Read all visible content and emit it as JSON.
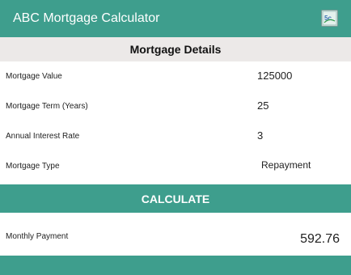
{
  "app": {
    "title": "ABC Mortgage Calculator",
    "icon": "calculator-icon",
    "accent_color": "#3e9e8d",
    "header_bg": "#ece9e8"
  },
  "section": {
    "title": "Mortgage Details"
  },
  "fields": {
    "value": {
      "label": "Mortgage Value",
      "value": "125000"
    },
    "term": {
      "label": "Mortgage Term (Years)",
      "value": "25"
    },
    "rate": {
      "label": "Annual Interest Rate",
      "value": "3"
    },
    "type": {
      "label": "Mortgage Type",
      "value": "Repayment"
    }
  },
  "actions": {
    "calculate_label": "CALCULATE"
  },
  "result": {
    "label": "Monthly Payment",
    "value": "592.76"
  }
}
